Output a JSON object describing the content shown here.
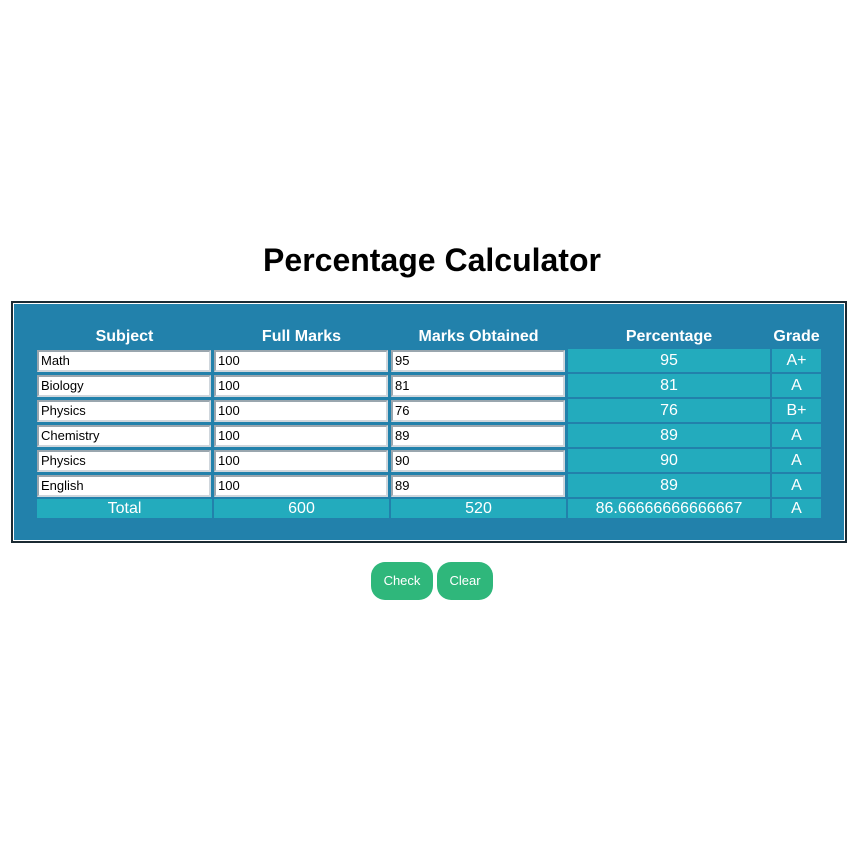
{
  "title": "Percentage Calculator",
  "table": {
    "headers": {
      "subject": "Subject",
      "full_marks": "Full Marks",
      "marks_obtained": "Marks Obtained",
      "percentage": "Percentage",
      "grade": "Grade"
    },
    "rows": [
      {
        "subject": "Math",
        "full_marks": "100",
        "marks_obtained": "95",
        "percentage": "95",
        "grade": "A+"
      },
      {
        "subject": "Biology",
        "full_marks": "100",
        "marks_obtained": "81",
        "percentage": "81",
        "grade": "A"
      },
      {
        "subject": "Physics",
        "full_marks": "100",
        "marks_obtained": "76",
        "percentage": "76",
        "grade": "B+"
      },
      {
        "subject": "Chemistry",
        "full_marks": "100",
        "marks_obtained": "89",
        "percentage": "89",
        "grade": "A"
      },
      {
        "subject": "Physics",
        "full_marks": "100",
        "marks_obtained": "90",
        "percentage": "90",
        "grade": "A"
      },
      {
        "subject": "English",
        "full_marks": "100",
        "marks_obtained": "89",
        "percentage": "89",
        "grade": "A"
      }
    ],
    "total": {
      "label": "Total",
      "full_marks": "600",
      "marks_obtained": "520",
      "percentage": "86.66666666666667",
      "grade": "A"
    }
  },
  "buttons": {
    "check": "Check",
    "clear": "Clear"
  },
  "colors": {
    "panel_bg": "#2281ab",
    "cell_bg": "#23abbd",
    "button_bg": "#2fb77b"
  }
}
